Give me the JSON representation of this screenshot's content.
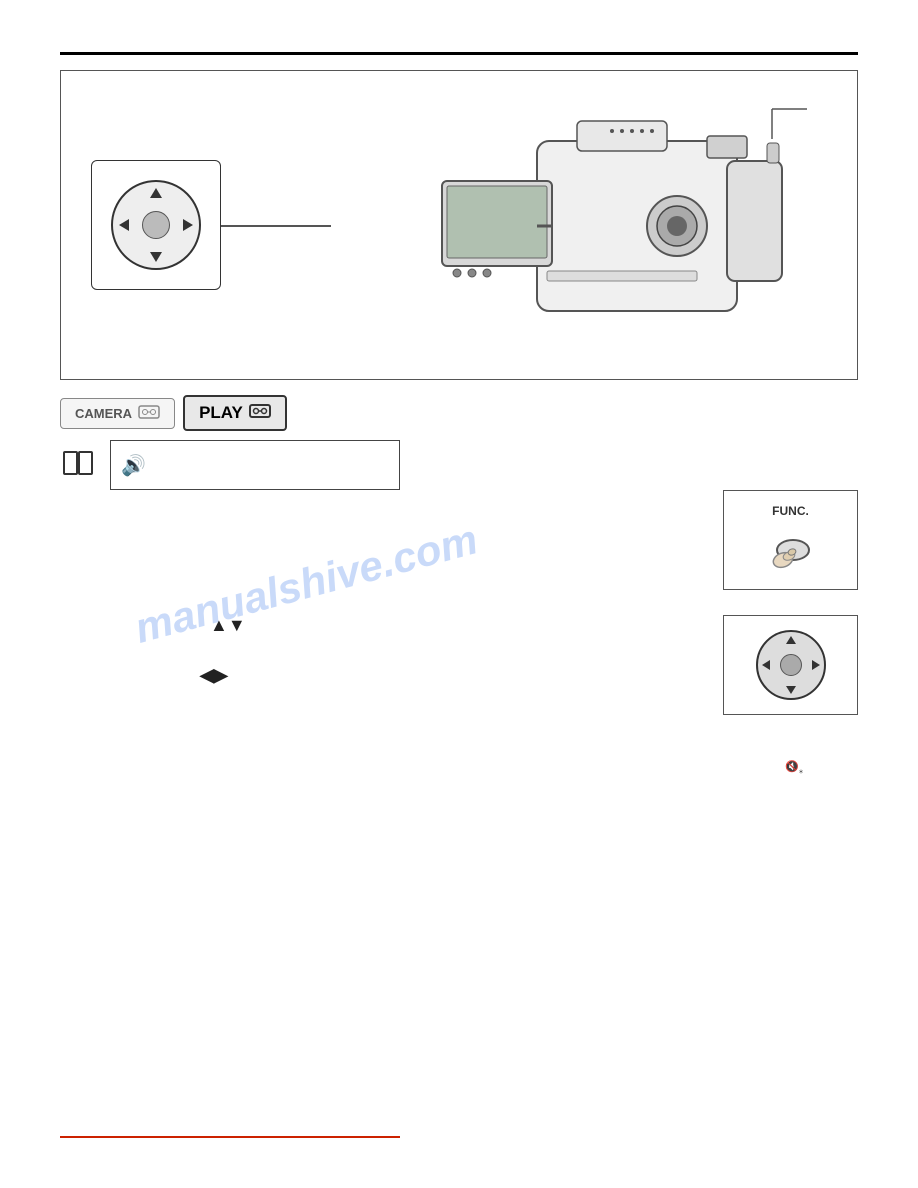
{
  "page": {
    "top_rule": true,
    "bottom_rule": true
  },
  "diagram": {
    "alt": "Camcorder with d-pad control diagram"
  },
  "mode_buttons": {
    "camera_label": "CAMERA",
    "camera_tape_symbol": "◻◻",
    "play_label": "PLAY",
    "play_tape_symbol": "◻◻"
  },
  "volume_box": {
    "speaker_symbol": "🔊",
    "text": ""
  },
  "func_box": {
    "label": "FUNC.",
    "alt": "Press FUNC button"
  },
  "dpad_right": {
    "alt": "D-pad navigation control"
  },
  "arrows": {
    "up_down": "▲▼",
    "left_right": "◀▶"
  },
  "vibrate_icon": {
    "symbol": "🔇"
  },
  "watermark": {
    "text": "manualshive.com"
  }
}
